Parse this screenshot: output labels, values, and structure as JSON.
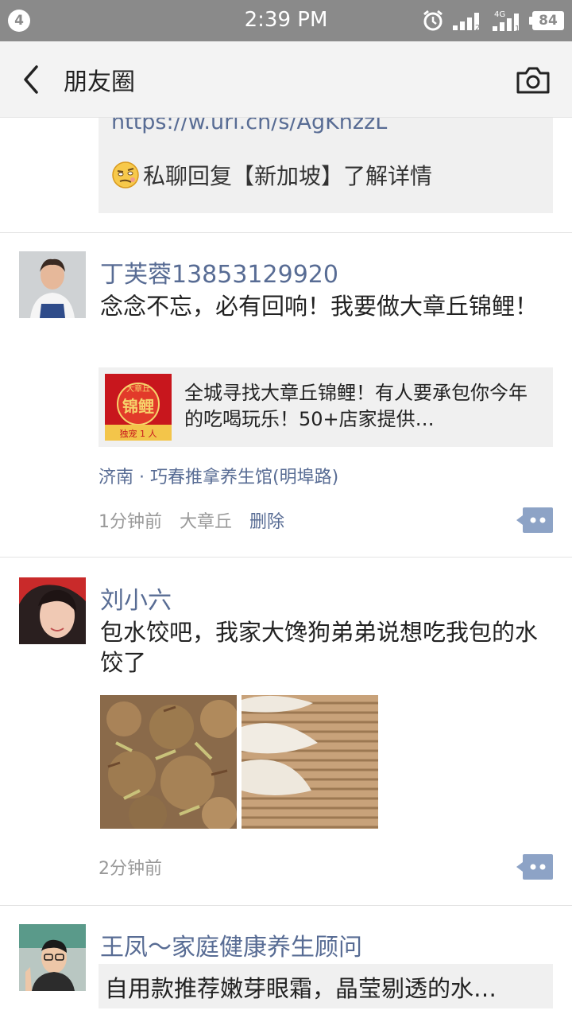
{
  "status_bar": {
    "notification_count": "4",
    "time": "2:39 PM",
    "network": "4G",
    "battery": "84"
  },
  "nav": {
    "title": "朋友圈"
  },
  "posts": [
    {
      "link_url": "https://w.url.cn/s/AgKhzzL",
      "reply_text": "私聊回复【新加坡】了解详情"
    },
    {
      "name": "丁芙蓉13853129920",
      "text": "念念不忘，必有回响！我要做大章丘锦鲤！",
      "article_text": "全城寻找大章丘锦鲤！有人要承包你今年的吃喝玩乐！50+店家提供…",
      "thumb_text_top": "大章丘",
      "thumb_text_main": "锦鲤",
      "thumb_text_bottom": "独宠 1 人",
      "location": "济南 · 巧春推拿养生馆(明埠路)",
      "time": "1分钟前",
      "source": "大章丘",
      "delete": "删除"
    },
    {
      "name": "刘小六",
      "text": "包水饺吧，我家大馋狗弟弟说想吃我包的水饺了",
      "time": "2分钟前"
    },
    {
      "name": "王凤～家庭健康养生顾问",
      "share_text": "自用款推荐嫩芽眼霜，晶莹剔透的水…"
    }
  ]
}
